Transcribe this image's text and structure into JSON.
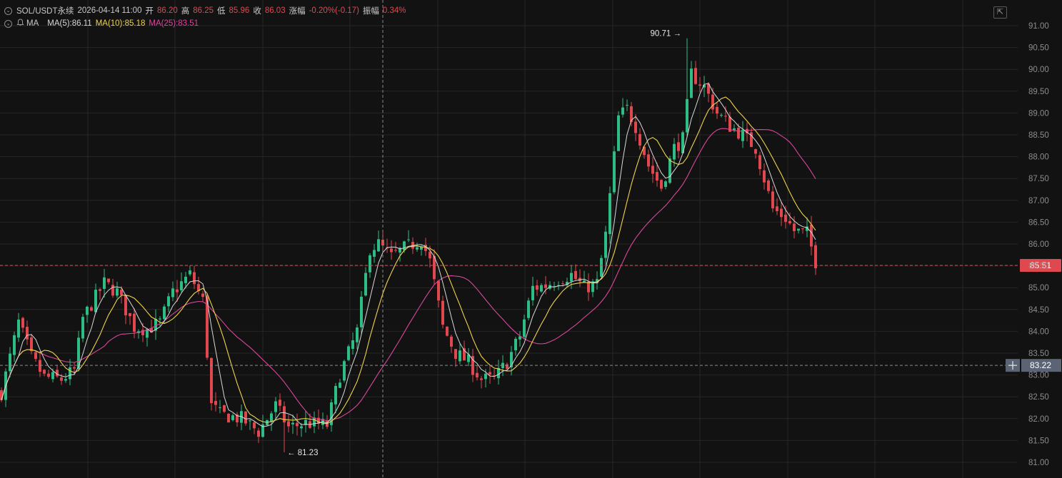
{
  "header": {
    "symbol": "SOL/USDT永续",
    "datetime": "2026-04-14 11:00",
    "open_label": "开",
    "open_value": "86.20",
    "high_label": "高",
    "high_value": "86.25",
    "low_label": "低",
    "low_value": "85.96",
    "close_label": "收",
    "close_value": "86.03",
    "change_label": "涨幅",
    "change_value": "-0.20%(-0.17)",
    "amplitude_label": "振幅",
    "amplitude_value": "0.34%"
  },
  "indicators": {
    "name": "MA",
    "ma5": "MA(5):86.11",
    "ma10": "MA(10):85.18",
    "ma25": "MA(25):83.51"
  },
  "colors": {
    "background": "#121212",
    "up": "#2ebd85",
    "down": "#e0484f",
    "ma5": "#d8d8d8",
    "ma10": "#f0d44a",
    "ma25": "#d9479b",
    "grid": "#262626"
  },
  "icons": {
    "toggle": "chevron-down-icon",
    "alarm": "bell-icon",
    "fullscreen": "expand-icon",
    "crosshair_add": "plus-icon"
  },
  "chart_data": {
    "type": "candlestick",
    "ylim": [
      80.8,
      91.3
    ],
    "y_ticks": [
      "91.00",
      "90.50",
      "90.00",
      "89.50",
      "89.00",
      "88.50",
      "88.00",
      "87.50",
      "87.00",
      "86.50",
      "86.00",
      "85.50",
      "85.00",
      "84.50",
      "84.00",
      "83.50",
      "83.00",
      "82.50",
      "82.00",
      "81.50",
      "81.00"
    ],
    "high_marker": {
      "label": "90.71",
      "value": 90.71,
      "index": 160
    },
    "low_marker": {
      "label": "81.23",
      "value": 81.23,
      "index": 66
    },
    "current_price": {
      "label": "85.51",
      "value": 85.51
    },
    "crosshair_price": {
      "label": "83.22",
      "value": 83.22
    },
    "crosshair_index": 89,
    "keypoints": [
      [
        0,
        82.6
      ],
      [
        4,
        84.2
      ],
      [
        7,
        83.4
      ],
      [
        10,
        82.95
      ],
      [
        14,
        82.9
      ],
      [
        17,
        83.1
      ],
      [
        19,
        84.3
      ],
      [
        24,
        85.1
      ],
      [
        27,
        84.9
      ],
      [
        31,
        84.1
      ],
      [
        34,
        84.05
      ],
      [
        37,
        84.2
      ],
      [
        40,
        84.9
      ],
      [
        44,
        85.3
      ],
      [
        47,
        84.7
      ],
      [
        49,
        82.3
      ],
      [
        51,
        82.1
      ],
      [
        56,
        82.0
      ],
      [
        60,
        81.7
      ],
      [
        64,
        82.3
      ],
      [
        67,
        81.8
      ],
      [
        71,
        81.9
      ],
      [
        76,
        81.85
      ],
      [
        79,
        83.0
      ],
      [
        83,
        84.0
      ],
      [
        86,
        85.9
      ],
      [
        88,
        86.0
      ],
      [
        91,
        85.7
      ],
      [
        94,
        85.9
      ],
      [
        98,
        86.1
      ],
      [
        100,
        85.6
      ],
      [
        103,
        84.1
      ],
      [
        106,
        83.5
      ],
      [
        109,
        83.3
      ],
      [
        112,
        82.9
      ],
      [
        115,
        82.9
      ],
      [
        118,
        83.3
      ],
      [
        121,
        83.9
      ],
      [
        124,
        85.0
      ],
      [
        127,
        85.05
      ],
      [
        130,
        85.2
      ],
      [
        133,
        85.3
      ],
      [
        136,
        85.0
      ],
      [
        139,
        85.1
      ],
      [
        141,
        86.2
      ],
      [
        144,
        88.9
      ],
      [
        146,
        89.1
      ],
      [
        148,
        88.7
      ],
      [
        151,
        87.8
      ],
      [
        154,
        87.3
      ],
      [
        157,
        88.2
      ],
      [
        159,
        88.4
      ],
      [
        161,
        89.9
      ],
      [
        164,
        89.6
      ],
      [
        167,
        89.0
      ],
      [
        170,
        88.7
      ],
      [
        173,
        88.5
      ],
      [
        176,
        88.2
      ],
      [
        178,
        87.5
      ],
      [
        180,
        86.8
      ],
      [
        183,
        86.6
      ],
      [
        185,
        86.3
      ],
      [
        188,
        86.25
      ],
      [
        190,
        85.6
      ]
    ]
  }
}
